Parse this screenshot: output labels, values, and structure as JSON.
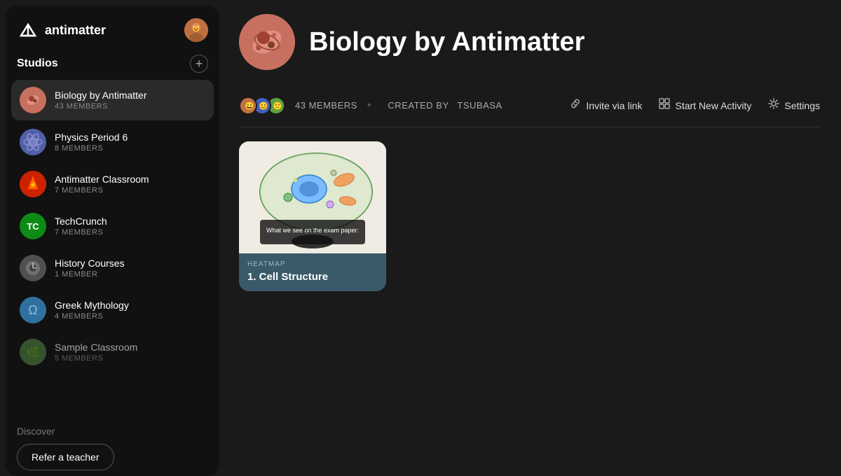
{
  "app": {
    "name": "antimatter"
  },
  "sidebar": {
    "studios_label": "Studios",
    "add_button_label": "+",
    "items": [
      {
        "id": "biology",
        "name": "Biology by Antimatter",
        "members": "43 MEMBERS",
        "icon_type": "biology",
        "active": true
      },
      {
        "id": "physics",
        "name": "Physics Period 6",
        "members": "8 MEMBERS",
        "icon_type": "physics",
        "active": false
      },
      {
        "id": "antimatter",
        "name": "Antimatter Classroom",
        "members": "7 MEMBERS",
        "icon_type": "antimatter",
        "active": false
      },
      {
        "id": "techcrunch",
        "name": "TechCrunch",
        "members": "7 MEMBERS",
        "icon_type": "techcrunch",
        "active": false
      },
      {
        "id": "history",
        "name": "History Courses",
        "members": "1 MEMBER",
        "icon_type": "history",
        "active": false
      },
      {
        "id": "greek",
        "name": "Greek Mythology",
        "members": "4 MEMBERS",
        "icon_type": "greek",
        "active": false
      },
      {
        "id": "sample",
        "name": "Sample Classroom",
        "members": "5 MEMBERS",
        "icon_type": "sample",
        "active": false
      }
    ],
    "discover_label": "Discover",
    "refer_button": "Refer a teacher"
  },
  "main": {
    "studio": {
      "title": "Biology by Antimatter",
      "members_count": "43 MEMBERS",
      "created_by_label": "CREATED BY",
      "creator": "TSUBASA",
      "separator": "•"
    },
    "actions": {
      "invite": "Invite via link",
      "start_activity": "Start New Activity",
      "settings": "Settings"
    },
    "activities": [
      {
        "type": "HEATMAP",
        "title": "1. Cell Structure",
        "image_alt": "Cell structure diagram"
      }
    ]
  }
}
